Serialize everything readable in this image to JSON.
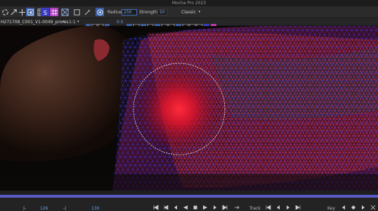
{
  "app": {
    "title": "Mocha Pro 2023"
  },
  "toolbar": {
    "radius_label": "Radius",
    "radius_value": "250",
    "strength_label": "Strength",
    "strength_value": "50",
    "mode_value": "Classic"
  },
  "clip_bar": {
    "clip_name": "H271708_C001_V1-0049_prores",
    "zoom_value": "1:1",
    "opacity_value": "0.5"
  },
  "timeline": {
    "in_value": "126",
    "current_value": "130",
    "track_label": "Track",
    "key_label": "Key"
  }
}
